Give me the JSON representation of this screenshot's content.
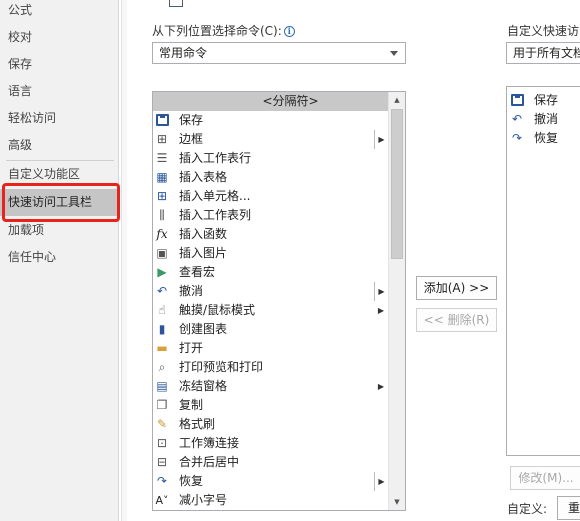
{
  "nav": {
    "items": [
      {
        "label": "公式",
        "top": 0
      },
      {
        "label": "校对",
        "top": 0
      },
      {
        "label": "保存",
        "top": 0
      },
      {
        "label": "语言",
        "top": 0
      },
      {
        "label": "轻松访问",
        "top": 0
      },
      {
        "label": "高级",
        "top": 0
      },
      {
        "label": "自定义功能区",
        "top": 0
      },
      {
        "label": "快速访问工具栏",
        "top": 0,
        "selected": true
      },
      {
        "label": "加载项",
        "top": 0
      },
      {
        "label": "信任中心",
        "top": 0
      }
    ],
    "highlight_color": "#e8231c"
  },
  "main": {
    "choose_label": "从下列位置选择命令(C):",
    "choose_value": "常用命令",
    "customize_label": "自定义快速访",
    "customize_value": "用于所有文档",
    "commands": [
      {
        "label": "<分隔符>",
        "icon": "separator",
        "header": true
      },
      {
        "label": "保存",
        "icon": "save-icon"
      },
      {
        "label": "边框",
        "icon": "border-icon",
        "submenu": "boxed"
      },
      {
        "label": "插入工作表行",
        "icon": "insert-row-icon"
      },
      {
        "label": "插入表格",
        "icon": "table-icon"
      },
      {
        "label": "插入单元格...",
        "icon": "insert-cells-icon"
      },
      {
        "label": "插入工作表列",
        "icon": "insert-column-icon"
      },
      {
        "label": "插入函数",
        "icon": "function-icon"
      },
      {
        "label": "插入图片",
        "icon": "picture-icon"
      },
      {
        "label": "查看宏",
        "icon": "macro-icon"
      },
      {
        "label": "撤消",
        "icon": "undo-icon",
        "submenu": "boxed"
      },
      {
        "label": "触摸/鼠标模式",
        "icon": "touch-icon",
        "submenu": "plain"
      },
      {
        "label": "创建图表",
        "icon": "chart-icon"
      },
      {
        "label": "打开",
        "icon": "folder-icon"
      },
      {
        "label": "打印预览和打印",
        "icon": "print-preview-icon"
      },
      {
        "label": "冻结窗格",
        "icon": "freeze-panes-icon",
        "submenu": "plain"
      },
      {
        "label": "复制",
        "icon": "copy-icon"
      },
      {
        "label": "格式刷",
        "icon": "format-painter-icon"
      },
      {
        "label": "工作簿连接",
        "icon": "connections-icon"
      },
      {
        "label": "合并后居中",
        "icon": "merge-center-icon"
      },
      {
        "label": "恢复",
        "icon": "redo-icon",
        "submenu": "boxed"
      },
      {
        "label": "减小字号",
        "icon": "decrease-font-icon"
      }
    ],
    "add_button": "添加(A) >>",
    "remove_button": "<< 删除(R)",
    "quick_access": [
      {
        "label": "保存",
        "icon": "save-icon"
      },
      {
        "label": "撤消",
        "icon": "undo-icon"
      },
      {
        "label": "恢复",
        "icon": "redo-icon"
      }
    ],
    "modify_button": "修改(M)...",
    "customize_bottom_label": "自定义:",
    "reset_button": "重"
  },
  "colors": {
    "icon_blue": "#2b579a",
    "nav_bg": "#f1f1f1",
    "nav_selected": "#c5c5c5"
  }
}
